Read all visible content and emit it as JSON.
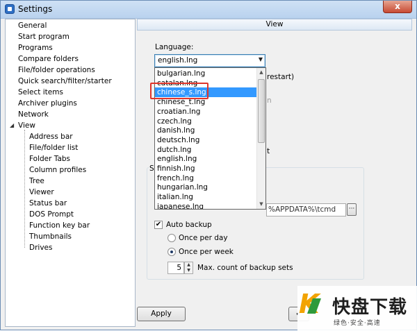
{
  "window": {
    "title": "Settings",
    "close_glyph": "x"
  },
  "tree": {
    "items": [
      {
        "label": "General",
        "level": 0
      },
      {
        "label": "Start program",
        "level": 0
      },
      {
        "label": "Programs",
        "level": 0
      },
      {
        "label": "Compare folders",
        "level": 0
      },
      {
        "label": "File/folder operations",
        "level": 0
      },
      {
        "label": "Quick search/filter/starter",
        "level": 0
      },
      {
        "label": "Select items",
        "level": 0
      },
      {
        "label": "Archiver plugins",
        "level": 0
      },
      {
        "label": "Network",
        "level": 0
      },
      {
        "label": "View",
        "level": 0,
        "expanded": true
      },
      {
        "label": "Address bar",
        "level": 1
      },
      {
        "label": "File/folder list",
        "level": 1
      },
      {
        "label": "Folder Tabs",
        "level": 1
      },
      {
        "label": "Column profiles",
        "level": 1
      },
      {
        "label": "Tree",
        "level": 1
      },
      {
        "label": "Viewer",
        "level": 1
      },
      {
        "label": "Status bar",
        "level": 1
      },
      {
        "label": "DOS Prompt",
        "level": 1
      },
      {
        "label": "Function key bar",
        "level": 1
      },
      {
        "label": "Thumbnails",
        "level": 1
      },
      {
        "label": "Drives",
        "level": 1
      }
    ],
    "expander_glyph": "◢"
  },
  "panel": {
    "header": "View"
  },
  "language": {
    "label": "Language:",
    "selected": "english.lng",
    "options": [
      "bulgarian.lng",
      "catalan.lng",
      "chinese_s.lng",
      "chinese_t.lng",
      "croatian.lng",
      "czech.lng",
      "danish.lng",
      "deutsch.lng",
      "dutch.lng",
      "english.lng",
      "finnish.lng",
      "french.lng",
      "hungarian.lng",
      "italian.lng",
      "japanese.lng"
    ],
    "highlighted": "chinese_s.lng"
  },
  "behind": {
    "restart_hint": "restart)",
    "n_hint": "n",
    "t_hint": "t",
    "group_caption": "S",
    "path_value": "%APPDATA%\\tcmd"
  },
  "backup": {
    "auto_label": "Auto backup",
    "auto_checked": true,
    "once_per_day": "Once per day",
    "once_per_week": "Once per week",
    "selected_frequency": "week",
    "max_count_value": "5",
    "max_count_label": "Max. count of backup sets"
  },
  "buttons": {
    "apply": "Apply",
    "ok_glyph": "✔"
  },
  "watermark": {
    "title": "快盘下载",
    "subtitle": "绿色·安全·高速"
  },
  "colors": {
    "selection": "#3399ff",
    "highlight_border": "#e0342a",
    "accent": "#3c7fb1"
  }
}
